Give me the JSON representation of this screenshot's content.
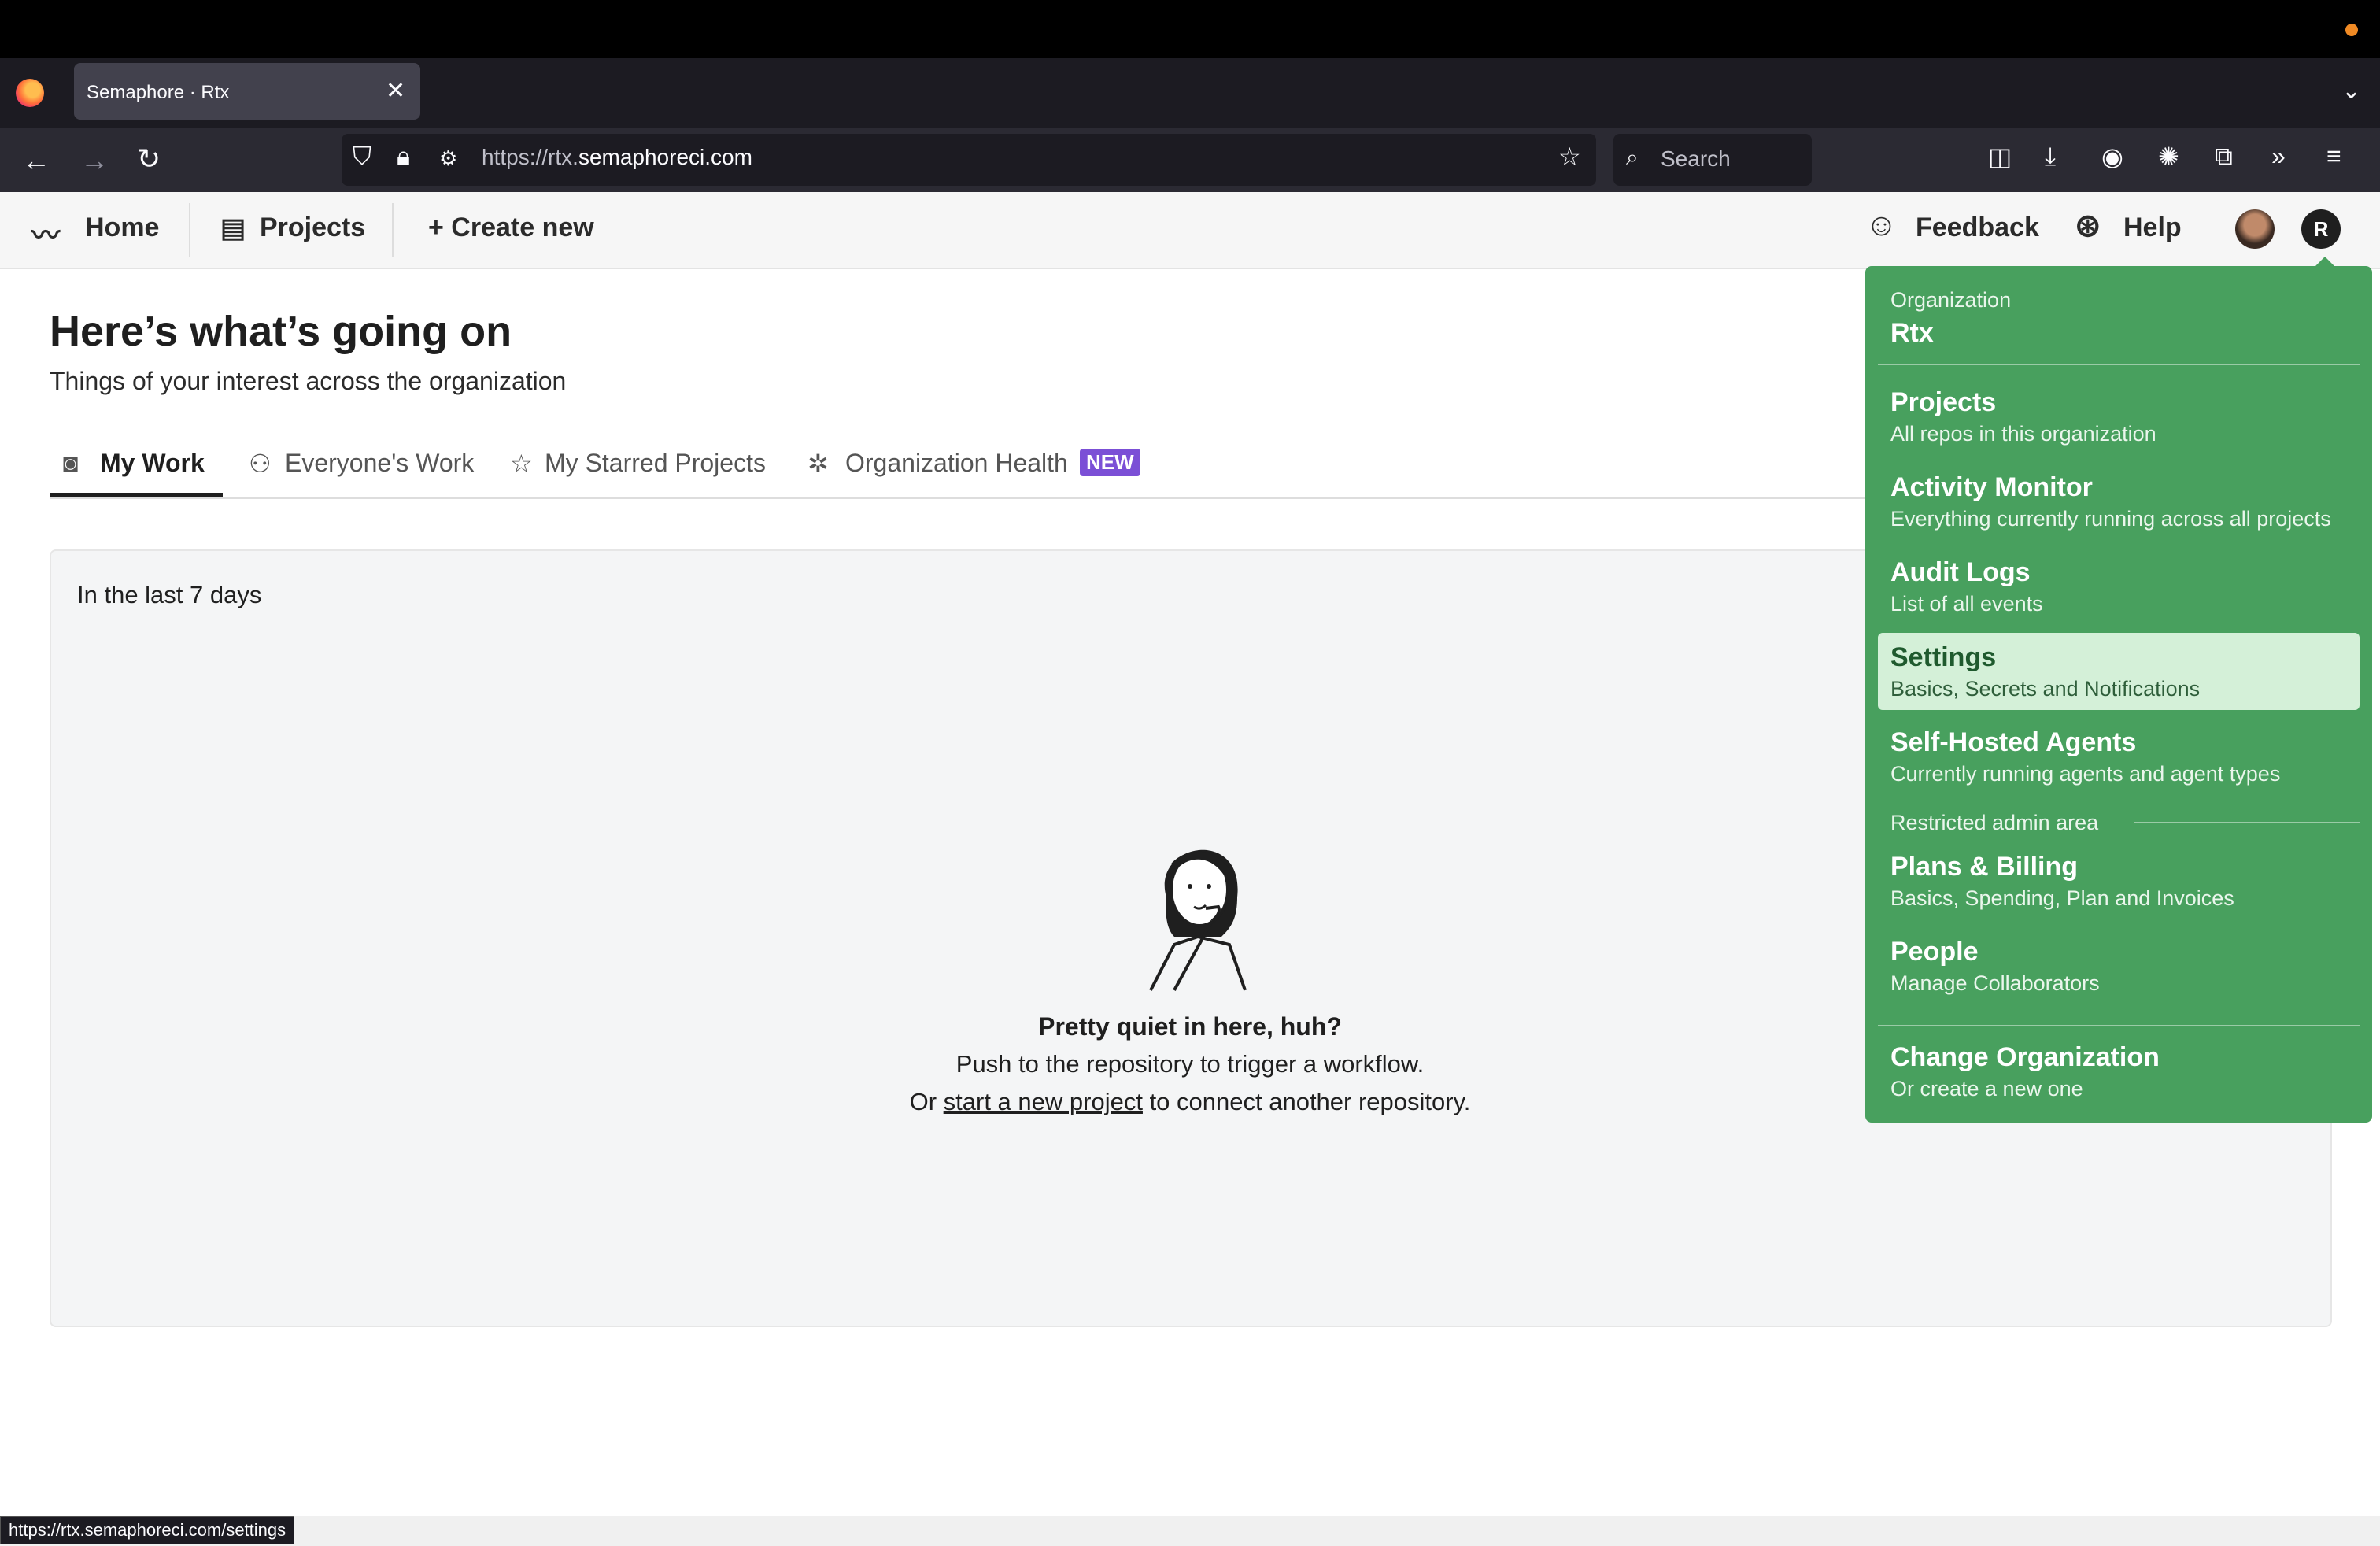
{
  "browser": {
    "tab_title": "Semaphore · Rtx",
    "tab_close": "✕",
    "url_prefix": "https://rtx.",
    "url_domain": "semaphoreci.com",
    "search_placeholder": "Search",
    "status_url": "https://rtx.semaphoreci.com/settings"
  },
  "header": {
    "home": "Home",
    "projects": "Projects",
    "create_new": "+ Create new",
    "feedback": "Feedback",
    "help": "Help",
    "avatar_initial": "R"
  },
  "main": {
    "title": "Here’s what’s going on",
    "subtitle": "Things of your interest across the organization",
    "tabs": [
      {
        "label": "My Work"
      },
      {
        "label": "Everyone's Work"
      },
      {
        "label": "My Starred Projects"
      },
      {
        "label": "Organization Health"
      }
    ],
    "badge": "NEW",
    "period": "In the last 7 days",
    "empty_title": "Pretty quiet in here, huh?",
    "empty_line1": "Push to the repository to trigger a workflow.",
    "empty_line2_pre": "Or ",
    "empty_line2_link": "start a new project",
    "empty_line2_post": " to connect another repository."
  },
  "dropdown": {
    "org_label": "Organization",
    "org_name": "Rtx",
    "items": [
      {
        "title": "Projects",
        "sub": "All repos in this organization"
      },
      {
        "title": "Activity Monitor",
        "sub": "Everything currently running across all projects"
      },
      {
        "title": "Audit Logs",
        "sub": "List of all events"
      },
      {
        "title": "Settings",
        "sub": "Basics, Secrets and Notifications"
      },
      {
        "title": "Self-Hosted Agents",
        "sub": "Currently running agents and agent types"
      }
    ],
    "restricted_label": "Restricted admin area",
    "admin_items": [
      {
        "title": "Plans & Billing",
        "sub": "Basics, Spending, Plan and Invoices"
      },
      {
        "title": "People",
        "sub": "Manage Collaborators"
      }
    ],
    "change_org": {
      "title": "Change Organization",
      "sub": "Or create a new one"
    }
  },
  "colors": {
    "dropdown_bg": "#48a05e",
    "highlight": "#d4f0d8",
    "badge": "#7b4fd6"
  }
}
